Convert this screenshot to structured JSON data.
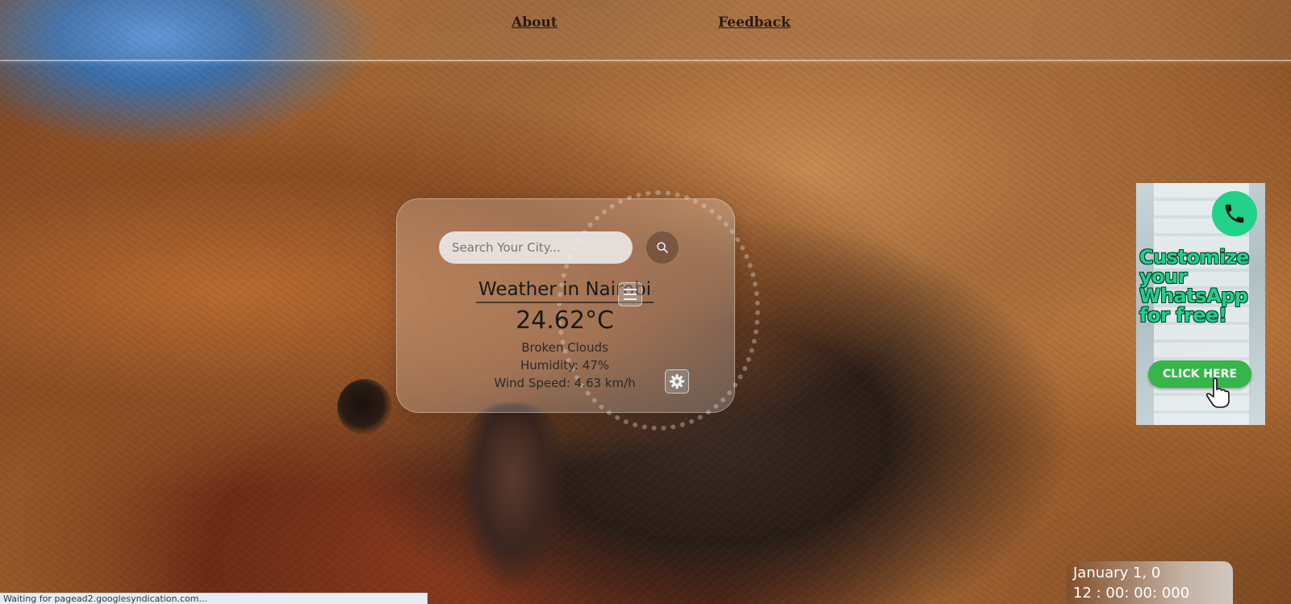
{
  "nav": {
    "about_label": "About",
    "feedback_label": "Feedback"
  },
  "weather": {
    "search_placeholder": "Search Your City...",
    "title": "Weather in Nairobi",
    "temperature": "24.62°C",
    "description": "Broken Clouds",
    "humidity": "Humidity: 47%",
    "wind_speed": "Wind Speed: 4.63 km/h"
  },
  "ad": {
    "headline": "Customize your WhatsApp for free!",
    "cta_label": "CLICK HERE",
    "icon": "phone-icon",
    "accent_color": "#22d28a",
    "cta_color": "#35b54a"
  },
  "clock": {
    "date": "January 1, 0",
    "time": "12 : 00: 00: 000"
  },
  "status": {
    "text": "Waiting for pagead2.googlesyndication.com..."
  },
  "icons": {
    "search": "search-icon",
    "menu": "menu-icon",
    "settings": "gear-icon"
  }
}
